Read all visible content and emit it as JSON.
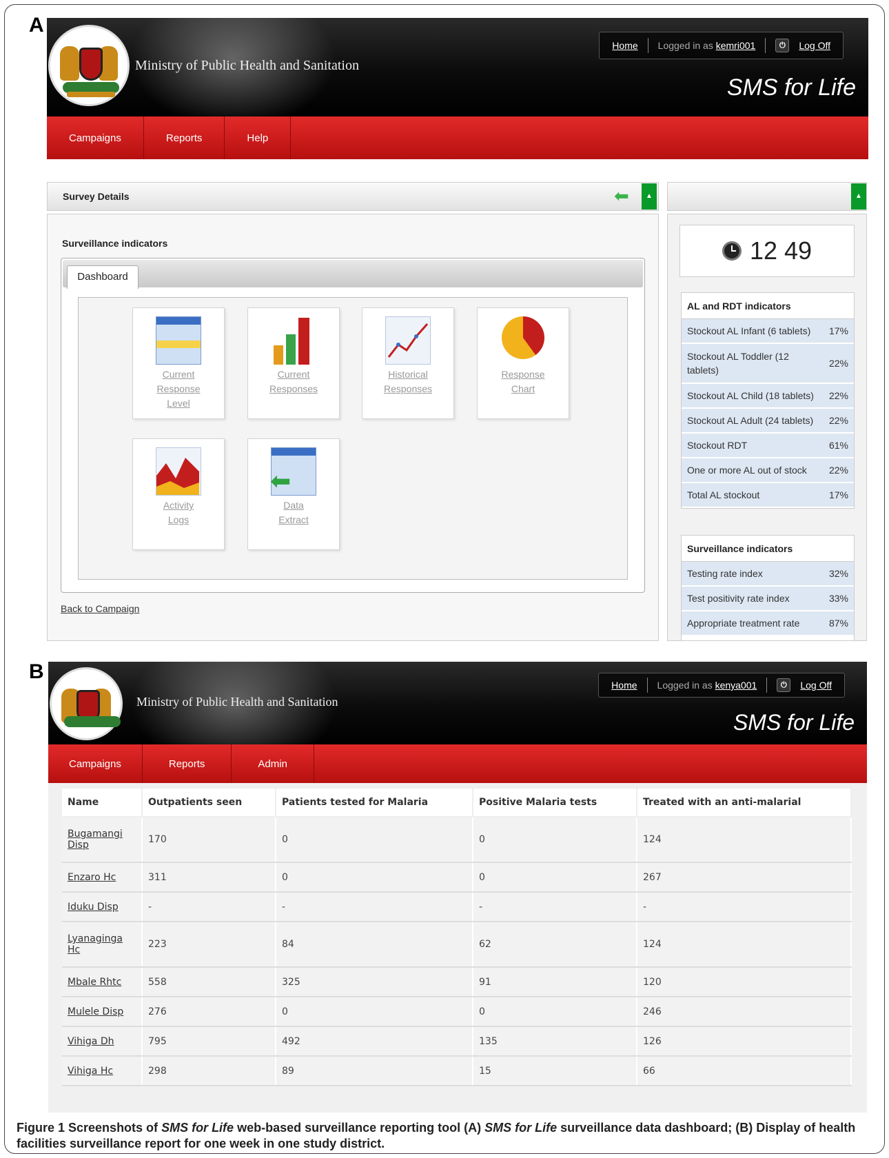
{
  "panel_a": {
    "label": "A",
    "ministry": "Ministry of Public Health and Sanitation",
    "nav": [
      "Campaigns",
      "Reports",
      "Help"
    ],
    "home": "Home",
    "logged_in_as": "Logged in as",
    "user": "kemri001",
    "log_off": "Log Off",
    "app_name": "SMS for Life",
    "survey_title": "Survey Details",
    "surveillance_heading": "Surveillance indicators",
    "tab": "Dashboard",
    "tiles": [
      {
        "line1": "Current",
        "line2": "Response",
        "line3": "Level"
      },
      {
        "line1": "Current",
        "line2": "Responses",
        "line3": ""
      },
      {
        "line1": "Historical",
        "line2": "Responses",
        "line3": ""
      },
      {
        "line1": "Response",
        "line2": "Chart",
        "line3": ""
      },
      {
        "line1": "Activity",
        "line2": "Logs",
        "line3": ""
      },
      {
        "line1": "Data",
        "line2": "Extract",
        "line3": ""
      }
    ],
    "back_link": "Back to Campaign",
    "clock": "12 49",
    "al_rdt": {
      "title": "AL and RDT indicators",
      "rows": [
        {
          "label": "Stockout AL Infant (6 tablets)",
          "value": "17%"
        },
        {
          "label": "Stockout AL Toddler (12 tablets)",
          "value": "22%"
        },
        {
          "label": "Stockout AL Child (18 tablets)",
          "value": "22%"
        },
        {
          "label": "Stockout AL Adult (24 tablets)",
          "value": "22%"
        },
        {
          "label": "Stockout RDT",
          "value": "61%"
        },
        {
          "label": "One or more AL out of stock",
          "value": "22%"
        },
        {
          "label": "Total AL stockout",
          "value": "17%"
        }
      ]
    },
    "surv": {
      "title": "Surveillance indicators",
      "rows": [
        {
          "label": "Testing rate index",
          "value": "32%"
        },
        {
          "label": "Test positivity rate index",
          "value": "33%"
        },
        {
          "label": "Appropriate treatment rate",
          "value": "87%"
        }
      ]
    }
  },
  "panel_b": {
    "label": "B",
    "ministry": "Ministry of Public Health and Sanitation",
    "nav": [
      "Campaigns",
      "Reports",
      "Admin"
    ],
    "home": "Home",
    "logged_in_as": "Logged in as",
    "user": "kenya001",
    "log_off": "Log Off",
    "app_name": "SMS for Life",
    "columns": [
      "Name",
      "Outpatients seen",
      "Patients tested for Malaria",
      "Positive Malaria tests",
      "Treated with an anti-malarial"
    ],
    "rows": [
      {
        "name1": "Bugamangi",
        "name2": "Disp",
        "c1": "170",
        "c2": "0",
        "c3": "0",
        "c4": "124"
      },
      {
        "name1": "Enzaro Hc",
        "name2": "",
        "c1": "311",
        "c2": "0",
        "c3": "0",
        "c4": "267"
      },
      {
        "name1": "Iduku Disp",
        "name2": "",
        "c1": "-",
        "c2": "-",
        "c3": "-",
        "c4": "-"
      },
      {
        "name1": "Lyanaginga",
        "name2": "Hc",
        "c1": "223",
        "c2": "84",
        "c3": "62",
        "c4": "124"
      },
      {
        "name1": "Mbale Rhtc",
        "name2": "",
        "c1": "558",
        "c2": "325",
        "c3": "91",
        "c4": "120"
      },
      {
        "name1": "Mulele Disp",
        "name2": "",
        "c1": "276",
        "c2": "0",
        "c3": "0",
        "c4": "246"
      },
      {
        "name1": "Vihiga Dh",
        "name2": "",
        "c1": "795",
        "c2": "492",
        "c3": "135",
        "c4": "126"
      },
      {
        "name1": "Vihiga Hc",
        "name2": "",
        "c1": "298",
        "c2": "89",
        "c3": "15",
        "c4": "66"
      }
    ]
  },
  "caption": {
    "fig": "Figure 1",
    "t1": " Screenshots of ",
    "sms1": "SMS for Life",
    "t2": " web-based surveillance reporting tool (A) ",
    "sms2": "SMS for Life",
    "t3": " surveillance data dashboard; (B) Display of health facilities surveillance report for one week in one study district."
  }
}
